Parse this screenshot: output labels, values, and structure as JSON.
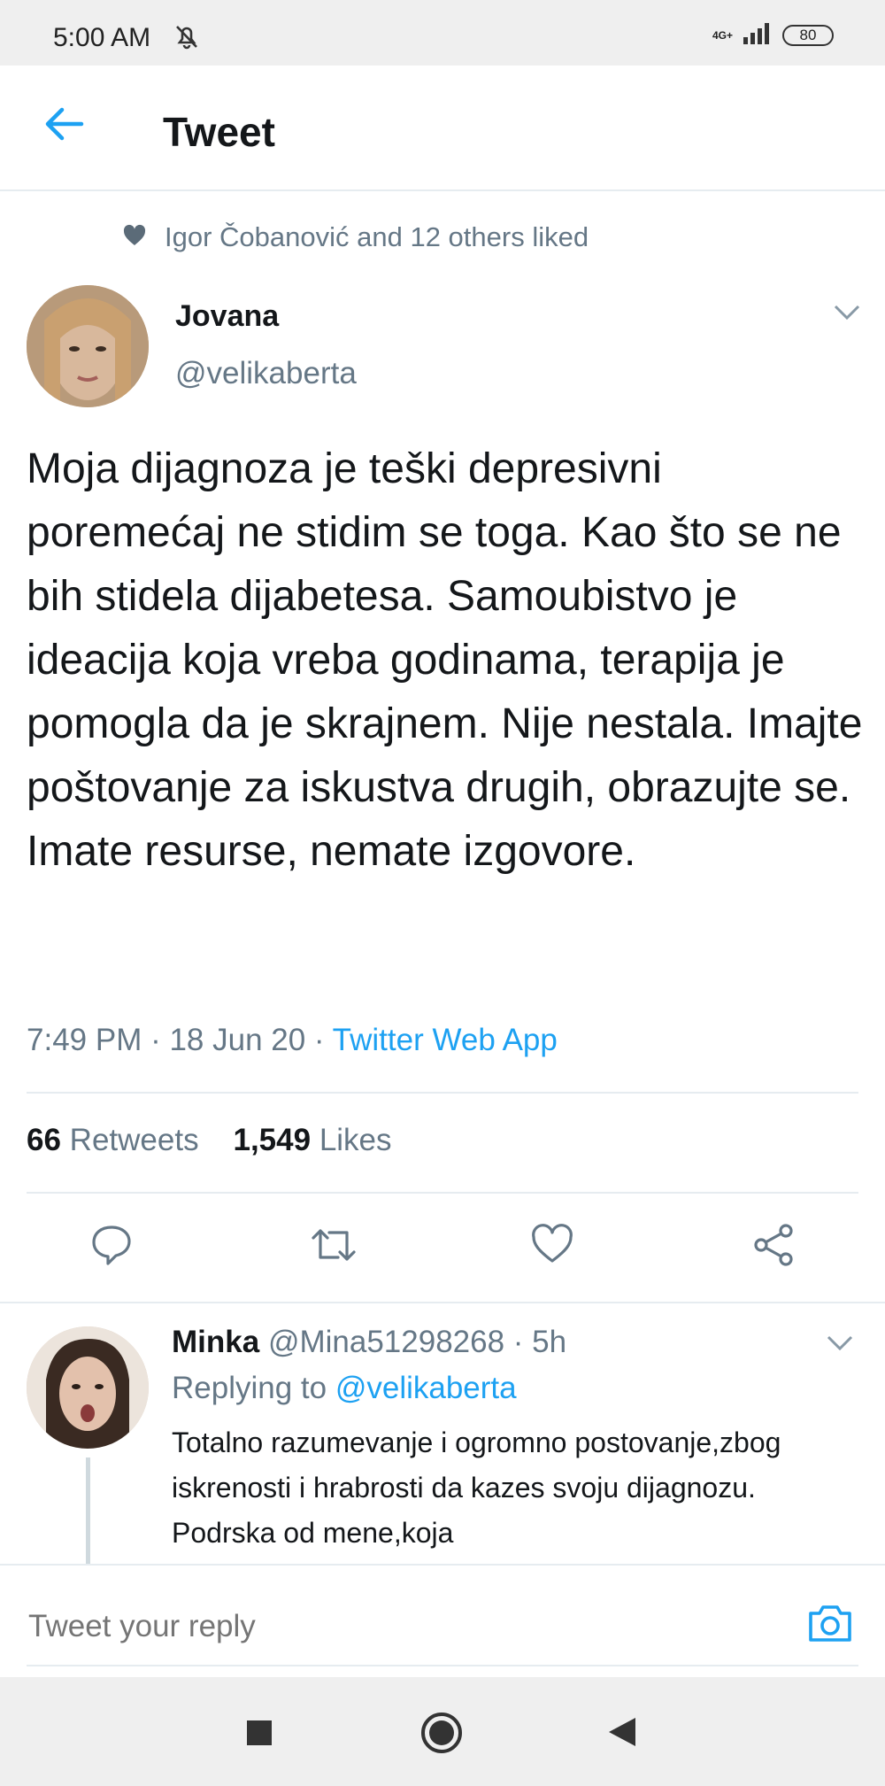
{
  "status_bar": {
    "time": "5:00 AM",
    "network_type": "4G+",
    "battery": "80"
  },
  "header": {
    "title": "Tweet"
  },
  "tweet": {
    "liked_by": "Igor Čobanović and 12 others liked",
    "author_name": "Jovana",
    "author_handle": "@velikaberta",
    "text": "Moja dijagnoza je teški depresivni poremećaj ne stidim se toga. Kao što se ne bih stidela dijabetesa. Samoubistvo je ideacija koja vreba godinama, terapija je pomogla da je skrajnem. Nije nestala. Imajte poštovanje za iskustva drugih, obrazujte se. Imate resurse, nemate izgovore.",
    "time_date": "7:49 PM · 18 Jun 20 · ",
    "source": "Twitter Web App",
    "retweets_count": "66",
    "retweets_label": "Retweets",
    "likes_count": "1,549",
    "likes_label": "Likes"
  },
  "reply": {
    "name": "Minka",
    "handle_time": "@Mina51298268 · 5h",
    "replying_prefix": "Replying to ",
    "replying_handle": "@velikaberta",
    "text": "Totalno razumevanje i ogromno postovanje,zbog iskrenosti i hrabrosti da kazes svoju dijagnozu. Podrska od mene,koja"
  },
  "compose": {
    "placeholder": "Tweet your reply"
  },
  "colors": {
    "accent": "#1da1f2",
    "secondary_text": "#657786",
    "primary_text": "#14171a"
  }
}
